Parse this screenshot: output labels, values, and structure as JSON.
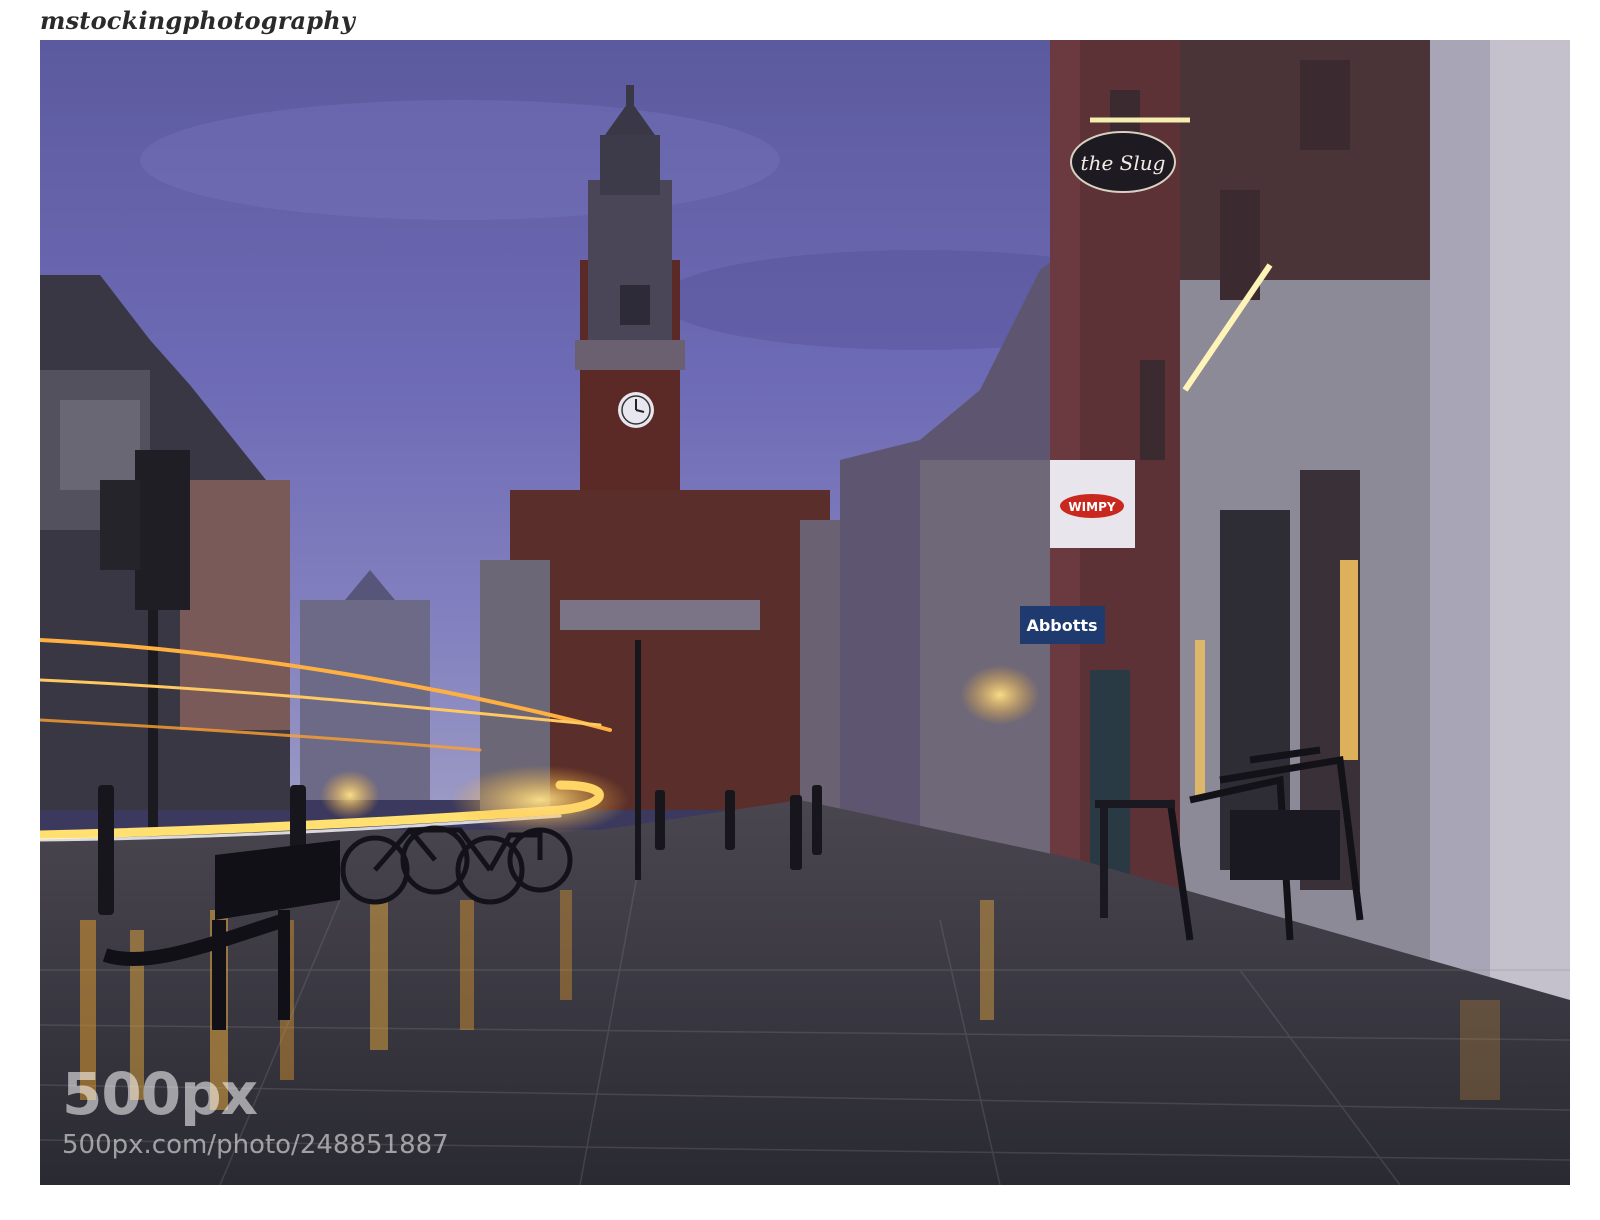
{
  "photo": {
    "credit": "mstockingphotography",
    "watermark_logo": "500px",
    "watermark_url": "500px.com/photo/248851887",
    "signs": {
      "pub_sign": "the Slug",
      "wimpy": "WIMPY",
      "abbotts": "Abbotts"
    }
  }
}
